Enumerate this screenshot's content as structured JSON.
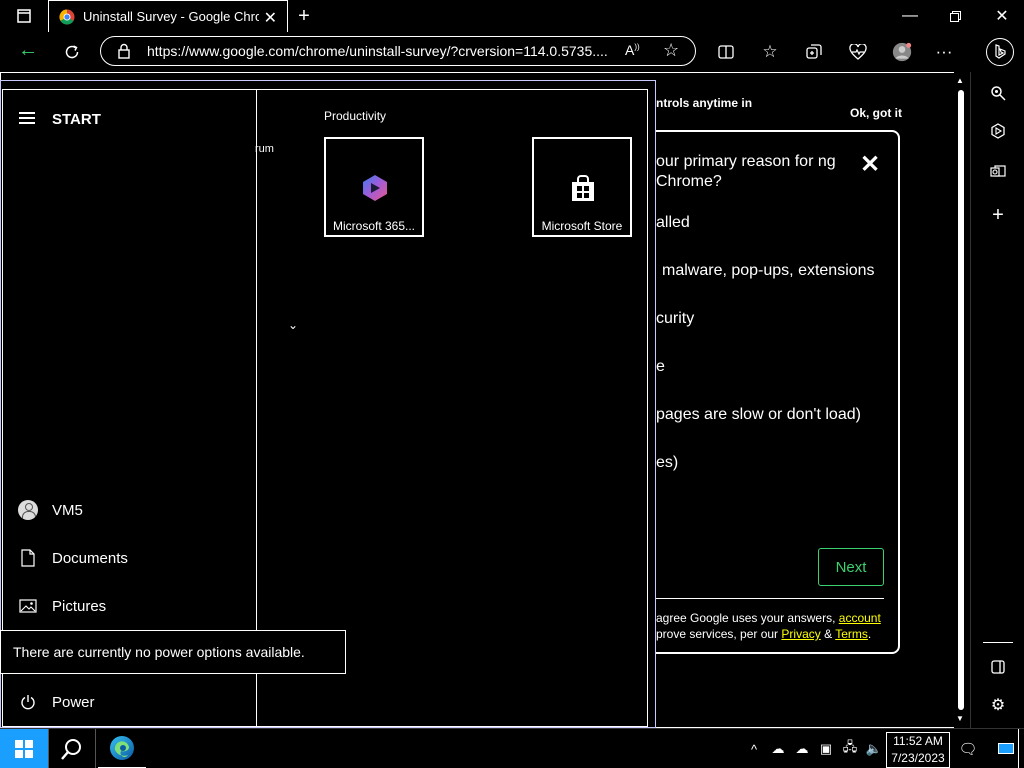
{
  "browser": {
    "tab_title": "Uninstall Survey - Google Chrome",
    "url": "https://www.google.com/chrome/uninstall-survey/?crversion=114.0.5735...."
  },
  "page": {
    "cookie_text": "ntrols anytime in",
    "got_it": "Ok, got it",
    "survey": {
      "question": "our primary reason for ng Chrome?",
      "options": [
        "alled",
        "malware, pop-ups, extensions",
        "curity",
        "e",
        "pages are slow or don't load)",
        "es)"
      ],
      "next_label": "Next",
      "footer_pre": "agree Google uses your answers,",
      "footer_link1": "account",
      "footer_mid": "prove services, per our",
      "footer_link2": "Privacy",
      "footer_amp": "&",
      "footer_link3": "Terms",
      "footer_end": "."
    }
  },
  "start_menu": {
    "title": "START",
    "partial_text": "rum",
    "group_title": "Productivity",
    "tiles": [
      {
        "label": "Microsoft 365..."
      },
      {
        "label": "Microsoft Store"
      }
    ],
    "items": [
      {
        "label": "VM5",
        "icon": "user-icon"
      },
      {
        "label": "Documents",
        "icon": "document-icon"
      },
      {
        "label": "Pictures",
        "icon": "pictures-icon"
      },
      {
        "label": "Power",
        "icon": "power-icon"
      }
    ],
    "power_tooltip": "There are currently no power options available."
  },
  "taskbar": {
    "time": "11:52 AM",
    "date": "7/23/2023"
  },
  "colors": {
    "accent_green": "#3bd16f",
    "link_yellow": "#ffff00",
    "start_blue": "#1a9fff"
  }
}
